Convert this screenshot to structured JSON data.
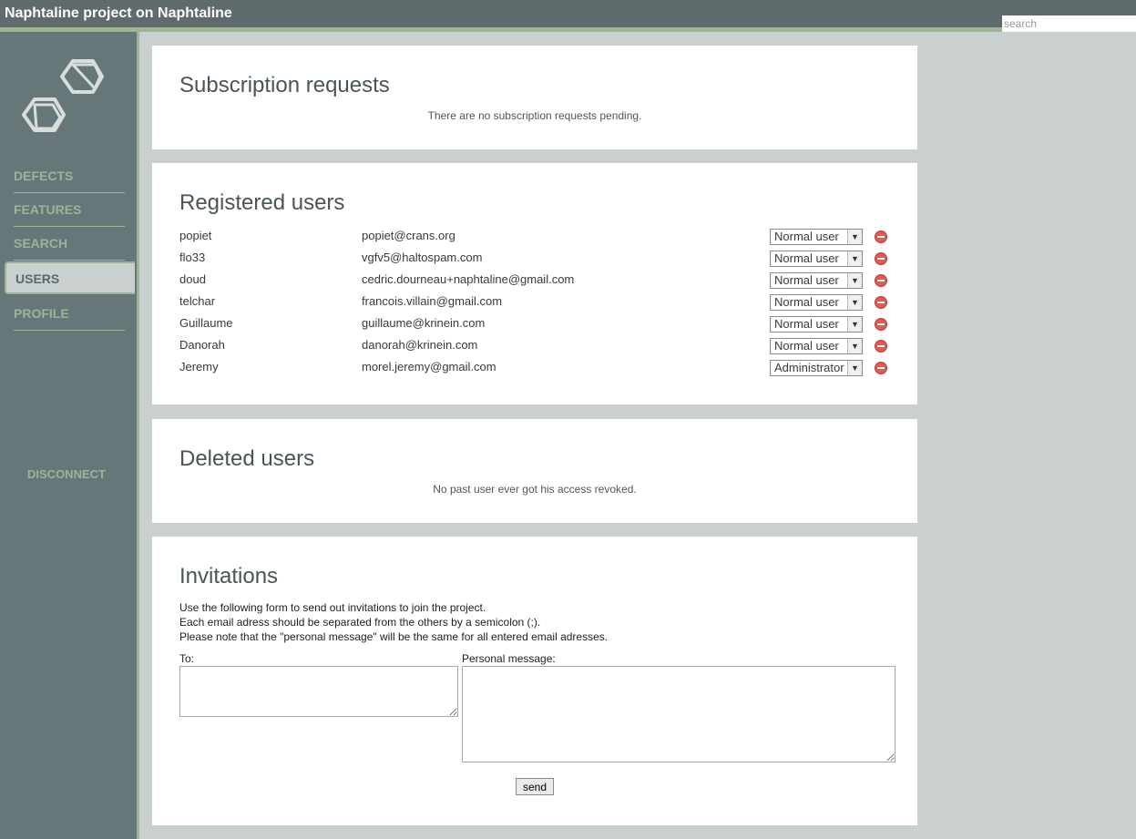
{
  "header": {
    "title": "Naphtaline project on Naphtaline"
  },
  "search": {
    "placeholder": "search"
  },
  "sidebar": {
    "items": [
      {
        "label": "DEFECTS"
      },
      {
        "label": "FEATURES"
      },
      {
        "label": "SEARCH"
      },
      {
        "label": "USERS",
        "active": true
      },
      {
        "label": "PROFILE"
      }
    ],
    "disconnect": "DISCONNECT"
  },
  "subscriptions": {
    "title": "Subscription requests",
    "empty_message": "There are no subscription requests pending."
  },
  "registered": {
    "title": "Registered users",
    "users": [
      {
        "name": "popiet",
        "email": "popiet@crans.org",
        "role": "Normal user"
      },
      {
        "name": "flo33",
        "email": "vgfv5@haltospam.com",
        "role": "Normal user"
      },
      {
        "name": "doud",
        "email": "cedric.dourneau+naphtaline@gmail.com",
        "role": "Normal user"
      },
      {
        "name": "telchar",
        "email": "francois.villain@gmail.com",
        "role": "Normal user"
      },
      {
        "name": "Guillaume",
        "email": "guillaume@krinein.com",
        "role": "Normal user"
      },
      {
        "name": "Danorah",
        "email": "danorah@krinein.com",
        "role": "Normal user"
      },
      {
        "name": "Jeremy",
        "email": "morel.jeremy@gmail.com",
        "role": "Administrator"
      }
    ]
  },
  "deleted": {
    "title": "Deleted users",
    "empty_message": "No past user ever got his access revoked."
  },
  "invitations": {
    "title": "Invitations",
    "line1": "Use the following form to send out invitations to join the project.",
    "line2": "Each email adress should be separated from the others by a semicolon (;).",
    "line3": "Please note that the \"personal message\" will be the same for all entered email adresses.",
    "to_label": "To:",
    "message_label": "Personal message:",
    "send_label": "send"
  },
  "colors": {
    "header_bg": "#5f6b6c",
    "sidebar_bg": "#66777a",
    "accent": "#9fb39a",
    "page_bg": "#c9d0cf",
    "delete": "#e05a55"
  }
}
